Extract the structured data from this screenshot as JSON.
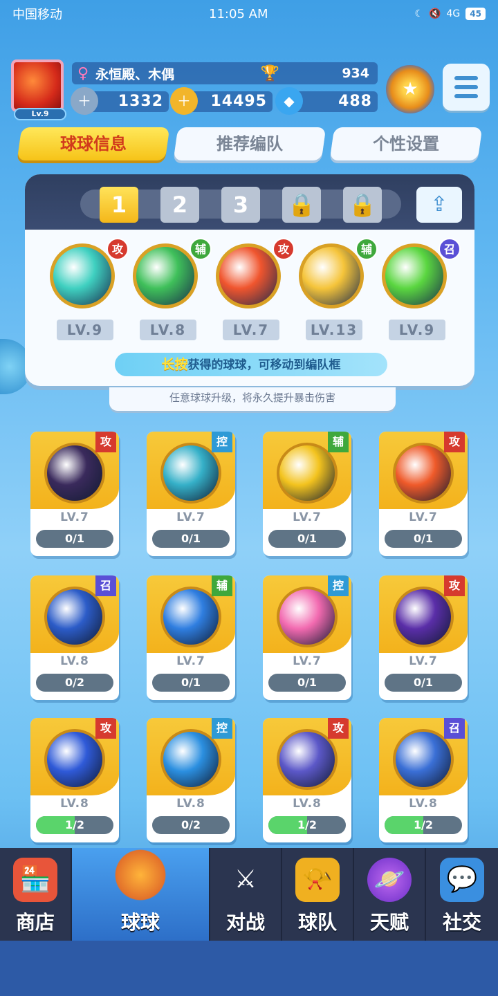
{
  "status": {
    "carrier": "中国移动",
    "time": "11:05 AM",
    "signal": "4G",
    "battery": "45"
  },
  "profile": {
    "level": "Lv.9",
    "name": "永恒殿、木偶",
    "trophies": "934",
    "currency1": "1332",
    "coins": "14495",
    "gems": "488"
  },
  "tabs": [
    "球球信息",
    "推荐编队",
    "个性设置"
  ],
  "team": {
    "slots": [
      "1",
      "2",
      "3"
    ],
    "members": [
      {
        "tag": "攻",
        "type": "atk",
        "level": "LV.9",
        "color": "#3fd0c0"
      },
      {
        "tag": "辅",
        "type": "sup",
        "level": "LV.8",
        "color": "#3fc05a"
      },
      {
        "tag": "攻",
        "type": "atk",
        "level": "LV.7",
        "color": "#f0552e"
      },
      {
        "tag": "辅",
        "type": "sup",
        "level": "LV.13",
        "color": "#f5c43a"
      },
      {
        "tag": "召",
        "type": "sum",
        "level": "LV.9",
        "color": "#5ad640"
      }
    ],
    "hint_em": "长按",
    "hint_rest": "获得的球球，可移动到编队框"
  },
  "tip": "任意球球升级，将永久提升暴击伤害",
  "balls": [
    {
      "tag": "攻",
      "type": "atk",
      "level": "LV.7",
      "progress": "0/1",
      "fill": 0,
      "color": "#3a2a5c"
    },
    {
      "tag": "控",
      "type": "ctl",
      "level": "LV.7",
      "progress": "0/1",
      "fill": 0,
      "color": "#35b0c8"
    },
    {
      "tag": "辅",
      "type": "sup",
      "level": "LV.7",
      "progress": "0/1",
      "fill": 0,
      "color": "#f3c31e"
    },
    {
      "tag": "攻",
      "type": "atk",
      "level": "LV.7",
      "progress": "0/1",
      "fill": 0,
      "color": "#ef5a2a"
    },
    {
      "tag": "召",
      "type": "sum",
      "level": "LV.8",
      "progress": "0/2",
      "fill": 0,
      "color": "#2c5cc8"
    },
    {
      "tag": "辅",
      "type": "sup",
      "level": "LV.7",
      "progress": "0/1",
      "fill": 0,
      "color": "#2f7ee0"
    },
    {
      "tag": "控",
      "type": "ctl",
      "level": "LV.7",
      "progress": "0/1",
      "fill": 0,
      "color": "#f26ab0"
    },
    {
      "tag": "攻",
      "type": "atk",
      "level": "LV.7",
      "progress": "0/1",
      "fill": 0,
      "color": "#5a2ea8"
    },
    {
      "tag": "攻",
      "type": "atk",
      "level": "LV.8",
      "progress": "1/2",
      "fill": 0.5,
      "color": "#2f5ad8"
    },
    {
      "tag": "控",
      "type": "ctl",
      "level": "LV.8",
      "progress": "0/2",
      "fill": 0,
      "color": "#2b8fe0"
    },
    {
      "tag": "攻",
      "type": "atk",
      "level": "LV.8",
      "progress": "1/2",
      "fill": 0.5,
      "color": "#5c58c8"
    },
    {
      "tag": "召",
      "type": "sum",
      "level": "LV.8",
      "progress": "1/2",
      "fill": 0.5,
      "color": "#3a6fd6"
    }
  ],
  "nav": [
    "商店",
    "球球",
    "对战",
    "球队",
    "天赋",
    "社交"
  ]
}
